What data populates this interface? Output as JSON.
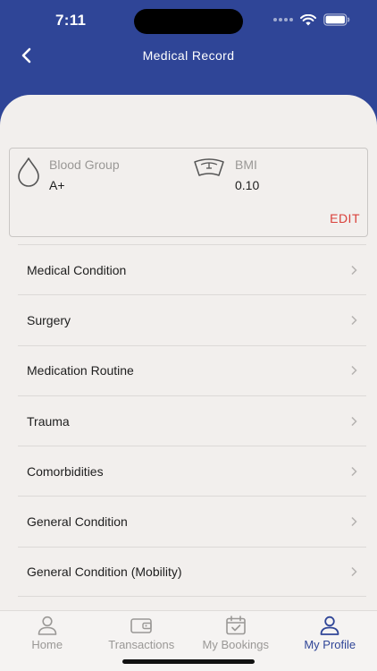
{
  "status": {
    "time": "7:11"
  },
  "nav": {
    "title": "Medical Record"
  },
  "vitals": {
    "blood_group": {
      "label": "Blood Group",
      "value": "A+"
    },
    "bmi": {
      "label": "BMI",
      "value": "0.10"
    },
    "edit_label": "EDIT"
  },
  "records": [
    {
      "label": "Medical Condition"
    },
    {
      "label": "Surgery"
    },
    {
      "label": "Medication Routine"
    },
    {
      "label": "Trauma"
    },
    {
      "label": "Comorbidities"
    },
    {
      "label": "General Condition"
    },
    {
      "label": "General Condition (Mobility)"
    }
  ],
  "tabs": [
    {
      "label": "Home",
      "icon": "person-icon"
    },
    {
      "label": "Transactions",
      "icon": "wallet-icon"
    },
    {
      "label": "My Bookings",
      "icon": "calendar-check-icon"
    },
    {
      "label": "My Profile",
      "icon": "person-icon",
      "active": true
    }
  ],
  "colors": {
    "header": "#2f4597",
    "sheet": "#f2efed",
    "edit": "#d9403a",
    "active_tab": "#2f4597"
  }
}
